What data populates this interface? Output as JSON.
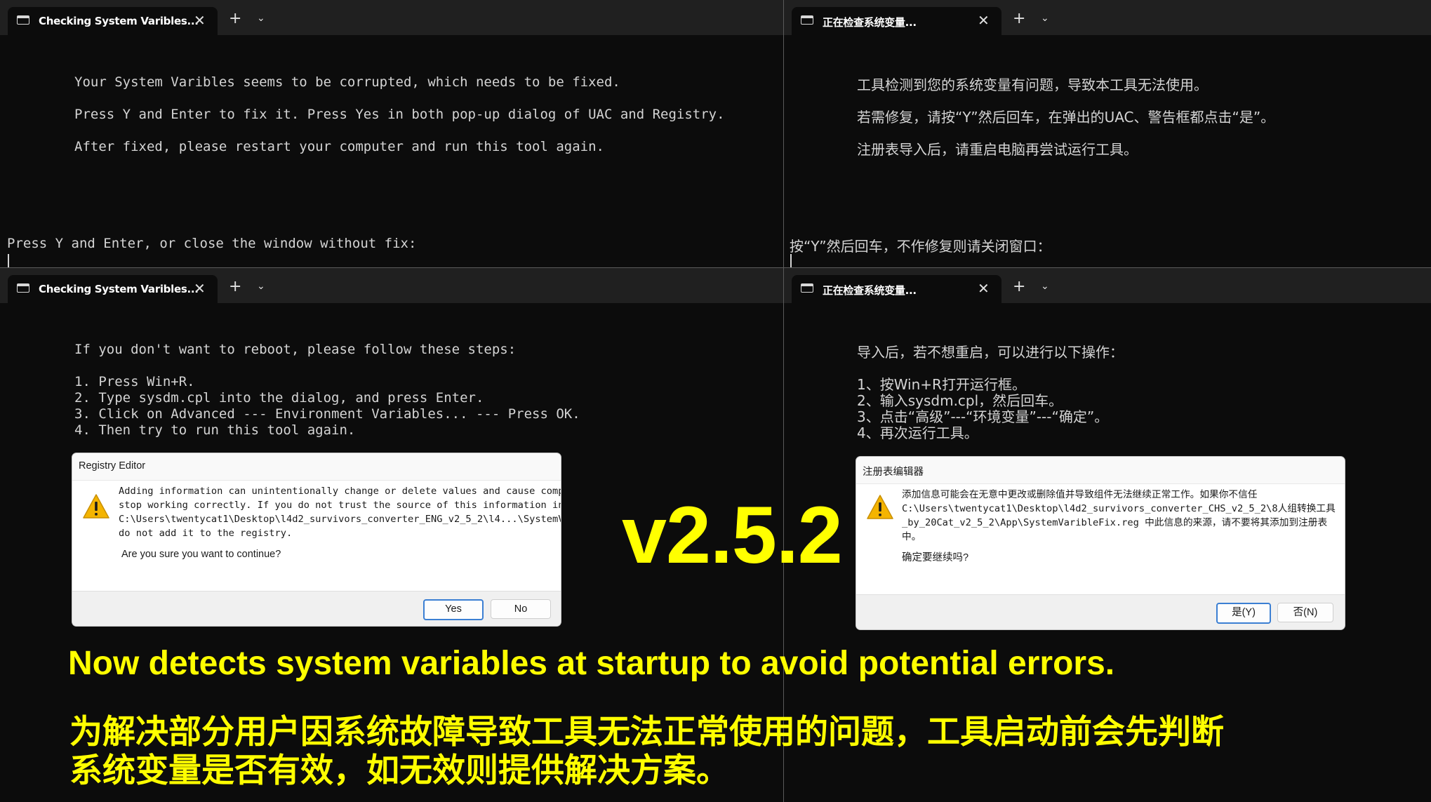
{
  "windows": [
    {
      "tab_title": "Checking System Varibles...",
      "lines": [
        "Your System Varibles seems to be corrupted, which needs to be fixed.",
        "Press Y and Enter to fix it. Press Yes in both pop-up dialog of UAC and Registry.",
        "After fixed, please restart your computer and run this tool again."
      ],
      "prompt": "Press Y and Enter, or close the window without fix:"
    },
    {
      "tab_title": "正在检查系统变量...",
      "lines": [
        "工具检测到您的系统变量有问题，导致本工具无法使用。",
        "若需修复，请按“Y”然后回车，在弹出的UAC、警告框都点击“是”。",
        "注册表导入后，请重启电脑再尝试运行工具。"
      ],
      "prompt": "按“Y”然后回车，不作修复则请关闭窗口："
    },
    {
      "tab_title": "Checking System Varibles...",
      "lines": [
        "If you don't want to reboot, please follow these steps:",
        "1. Press Win+R.",
        "2. Type sysdm.cpl into the dialog, and press Enter.",
        "3. Click on Advanced --- Environment Variables... --- Press OK.",
        "4. Then try to run this tool again."
      ]
    },
    {
      "tab_title": "正在检查系统变量...",
      "lines": [
        "导入后，若不想重启，可以进行以下操作：",
        "1、按Win+R打开运行框。",
        "2、输入sysdm.cpl，然后回车。",
        "3、点击“高级”---“环境变量”---“确定”。",
        "4、再次运行工具。"
      ]
    }
  ],
  "dialogs": [
    {
      "title": "Registry Editor",
      "message": "Adding information can unintentionally change or delete values and cause components to\nstop working correctly. If you do not trust the source of this information in\nC:\\Users\\twentycat1\\Desktop\\l4d2_survivors_converter_ENG_v2_5_2\\l4...\\SystemVaribleFix.reg,\ndo not add it to the registry.",
      "question": "Are you sure you want to continue?",
      "yes_label": "Yes",
      "no_label": "No",
      "icon": "warning-icon"
    },
    {
      "title": "注册表编辑器",
      "message": "添加信息可能会在无意中更改或删除值并导致组件无法继续正常工作。如果你不信任\nC:\\Users\\twentycat1\\Desktop\\l4d2_survivors_converter_CHS_v2_5_2\\8人组转换工具\n_by_20Cat_v2_5_2\\App\\SystemVaribleFix.reg 中此信息的来源，请不要将其添加到注册表\n中。",
      "question": "确定要继续吗?",
      "yes_label": "是(Y)",
      "no_label": "否(N)",
      "icon": "warning-icon"
    }
  ],
  "tab_close_glyph": "✕",
  "tab_add_glyph": "+",
  "tab_menu_glyph": "⌄",
  "version": "v2.5.2",
  "caption_en": "Now detects system variables at startup to avoid potential errors.",
  "caption_cn": "为解决部分用户因系统故障导致工具无法正常使用的问题，工具启动前会先判断\n系统变量是否有效，如无效则提供解决方案。",
  "colors": {
    "terminal_bg": "#0c0c0c",
    "tabbar_bg": "#202020",
    "terminal_text": "#d4d4d4",
    "caption": "#ffff00",
    "warning": "#f4b400",
    "dialog_default_border": "#3b7fd3"
  }
}
